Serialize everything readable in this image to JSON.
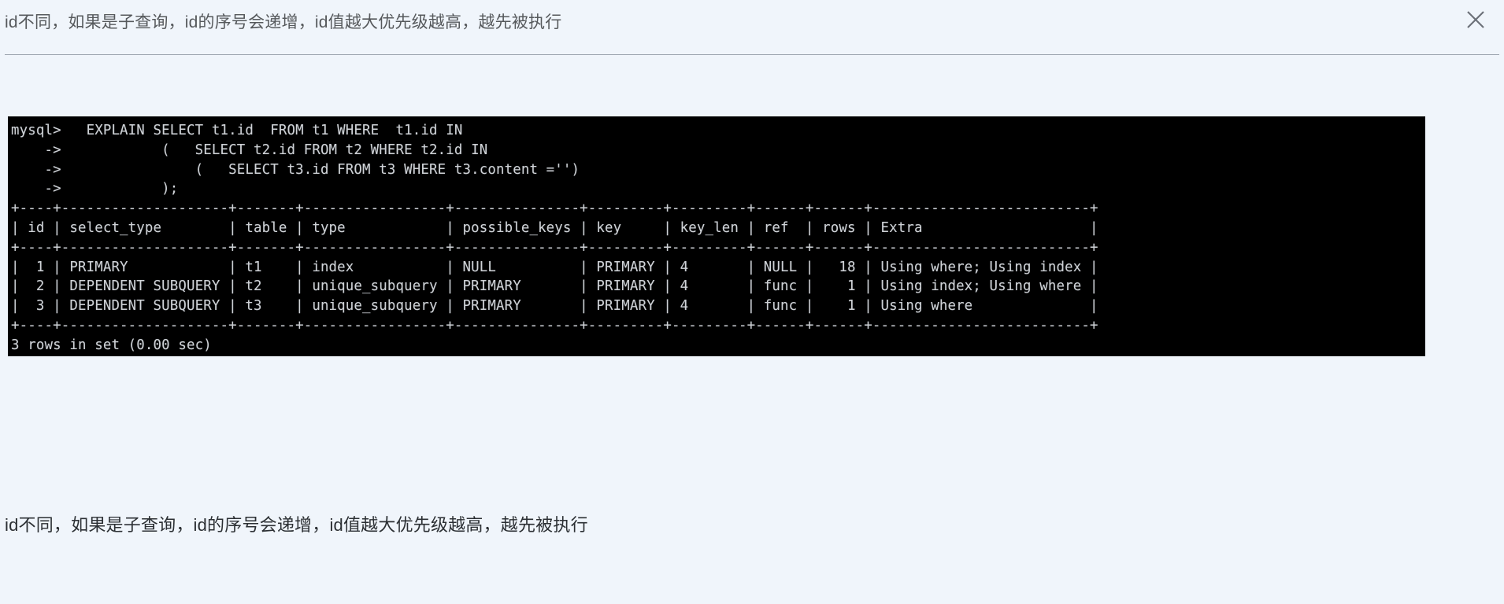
{
  "header": {
    "title": "id不同，如果是子查询，id的序号会递增，id值越大优先级越高，越先被执行",
    "close_icon": "close-icon",
    "close_label": "✕"
  },
  "colors": {
    "page_background": "#f0f5fb",
    "terminal_background": "#000000",
    "terminal_text": "#cfd2d6",
    "header_text": "#56595c",
    "body_text": "#2b2f33",
    "divider": "#9aa3ad"
  },
  "terminal": {
    "prompt": "mysql>",
    "continuation_prompt": "->",
    "query_lines": [
      "mysql>   EXPLAIN SELECT t1.id  FROM t1 WHERE  t1.id IN",
      "    ->            (   SELECT t2.id FROM t2 WHERE t2.id IN",
      "    ->                (   SELECT t3.id FROM t3 WHERE t3.content ='')",
      "    ->            );"
    ],
    "result_table": {
      "columns": [
        "id",
        "select_type",
        "table",
        "type",
        "possible_keys",
        "key",
        "key_len",
        "ref",
        "rows",
        "Extra"
      ],
      "rows": [
        {
          "id": "1",
          "select_type": "PRIMARY",
          "table": "t1",
          "type": "index",
          "possible_keys": "NULL",
          "key": "PRIMARY",
          "key_len": "4",
          "ref": "NULL",
          "rows": "18",
          "Extra": "Using where; Using index"
        },
        {
          "id": "2",
          "select_type": "DEPENDENT SUBQUERY",
          "table": "t2",
          "type": "unique_subquery",
          "possible_keys": "PRIMARY",
          "key": "PRIMARY",
          "key_len": "4",
          "ref": "func",
          "rows": "1",
          "Extra": "Using index; Using where"
        },
        {
          "id": "3",
          "select_type": "DEPENDENT SUBQUERY",
          "table": "t3",
          "type": "unique_subquery",
          "possible_keys": "PRIMARY",
          "key": "PRIMARY",
          "key_len": "4",
          "ref": "func",
          "rows": "1",
          "Extra": "Using where"
        }
      ]
    },
    "status_line": "3 rows in set (0.00 sec)",
    "rendered_text": "mysql>   EXPLAIN SELECT t1.id  FROM t1 WHERE  t1.id IN\n    ->            (   SELECT t2.id FROM t2 WHERE t2.id IN\n    ->                (   SELECT t3.id FROM t3 WHERE t3.content ='')\n    ->            );\n+----+--------------------+-------+-----------------+---------------+---------+---------+------+------+--------------------------+\n| id | select_type        | table | type            | possible_keys | key     | key_len | ref  | rows | Extra                    |\n+----+--------------------+-------+-----------------+---------------+---------+---------+------+------+--------------------------+\n|  1 | PRIMARY            | t1    | index           | NULL          | PRIMARY | 4       | NULL |   18 | Using where; Using index |\n|  2 | DEPENDENT SUBQUERY | t2    | unique_subquery | PRIMARY       | PRIMARY | 4       | func |    1 | Using index; Using where |\n|  3 | DEPENDENT SUBQUERY | t3    | unique_subquery | PRIMARY       | PRIMARY | 4       | func |    1 | Using where              |\n+----+--------------------+-------+-----------------+---------------+---------+---------+------+------+--------------------------+\n3 rows in set (0.00 sec)"
  },
  "body": {
    "paragraph": "id不同，如果是子查询，id的序号会递增，id值越大优先级越高，越先被执行"
  }
}
